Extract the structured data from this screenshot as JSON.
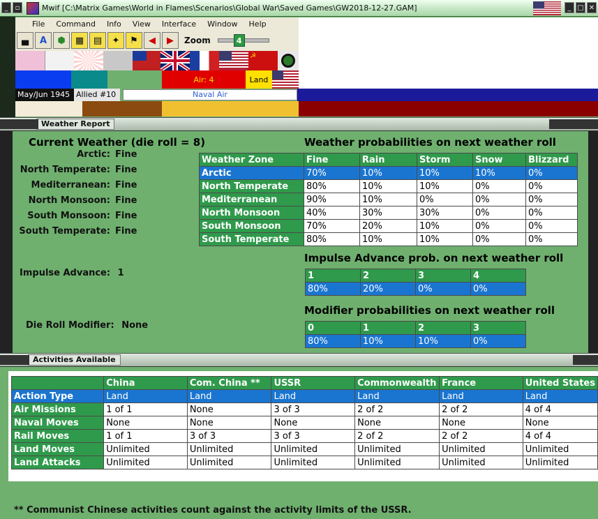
{
  "window": {
    "title": "Mwif [C:\\Matrix Games\\World in Flames\\Scenarios\\Global War\\Saved Games\\GW2018-12-27.GAM]"
  },
  "menu": [
    "File",
    "Command",
    "Info",
    "View",
    "Interface",
    "Window",
    "Help"
  ],
  "toolbar": {
    "zoom_label": "Zoom",
    "zoom_value": "4",
    "zoom_level": 4
  },
  "status": {
    "date": "May/Jun 1945",
    "side": "Allied #10",
    "phase": "Naval Air",
    "air_label": "Air: 4",
    "land_label": "Land"
  },
  "colors": {
    "accent_green": "#2f9a4b",
    "selection_blue": "#1a75d0",
    "background_green": "#6fb06f"
  },
  "weather_panel": {
    "header": "Weather Report",
    "current_title": "Current Weather (die roll = 8)",
    "current": [
      {
        "zone": "Arctic:",
        "value": "Fine"
      },
      {
        "zone": "North Temperate:",
        "value": "Fine"
      },
      {
        "zone": "Mediterranean:",
        "value": "Fine"
      },
      {
        "zone": "North Monsoon:",
        "value": "Fine"
      },
      {
        "zone": "South Monsoon:",
        "value": "Fine"
      },
      {
        "zone": "South Temperate:",
        "value": "Fine"
      }
    ],
    "impulse_label": "Impulse Advance:",
    "impulse_value": "1",
    "die_label": "Die Roll Modifier:",
    "die_value": "None",
    "prob_title": "Weather probabilities on next weather roll",
    "prob_headers": [
      "Weather Zone",
      "Fine",
      "Rain",
      "Storm",
      "Snow",
      "Blizzard"
    ],
    "prob_rows": [
      [
        "Arctic",
        "70%",
        "10%",
        "10%",
        "10%",
        "0%"
      ],
      [
        "North Temperate",
        "80%",
        "10%",
        "10%",
        "0%",
        "0%"
      ],
      [
        "Mediterranean",
        "90%",
        "10%",
        "0%",
        "0%",
        "0%"
      ],
      [
        "North Monsoon",
        "40%",
        "30%",
        "30%",
        "0%",
        "0%"
      ],
      [
        "South Monsoon",
        "70%",
        "20%",
        "10%",
        "0%",
        "0%"
      ],
      [
        "South Temperate",
        "80%",
        "10%",
        "10%",
        "0%",
        "0%"
      ]
    ],
    "impulse_title": "Impulse Advance prob. on next weather roll",
    "impulse_headers": [
      "1",
      "2",
      "3",
      "4"
    ],
    "impulse_values": [
      "80%",
      "20%",
      "0%",
      "0%"
    ],
    "modifier_title": "Modifier probabilities on next weather roll",
    "modifier_headers": [
      "0",
      "1",
      "2",
      "3"
    ],
    "modifier_values": [
      "80%",
      "10%",
      "10%",
      "0%"
    ]
  },
  "activities_panel": {
    "header": "Activities Available",
    "columns": [
      "",
      "China",
      "Com. China **",
      "USSR",
      "Commonwealth",
      "France",
      "United States"
    ],
    "rows": [
      [
        "Action Type",
        "Land",
        "Land",
        "Land",
        "Land",
        "Land",
        "Land"
      ],
      [
        "Air Missions",
        "1 of 1",
        "None",
        "3 of 3",
        "2 of 2",
        "2 of 2",
        "4 of 4"
      ],
      [
        "Naval Moves",
        "None",
        "None",
        "None",
        "None",
        "None",
        "None"
      ],
      [
        "Rail Moves",
        "1 of 1",
        "3 of 3",
        "3 of 3",
        "2 of 2",
        "2 of 2",
        "4 of 4"
      ],
      [
        "Land Moves",
        "Unlimited",
        "Unlimited",
        "Unlimited",
        "Unlimited",
        "Unlimited",
        "Unlimited"
      ],
      [
        "Land Attacks",
        "Unlimited",
        "Unlimited",
        "Unlimited",
        "Unlimited",
        "Unlimited",
        "Unlimited"
      ]
    ],
    "footnote": "** Communist Chinese activities count against the activity limits of the USSR."
  }
}
